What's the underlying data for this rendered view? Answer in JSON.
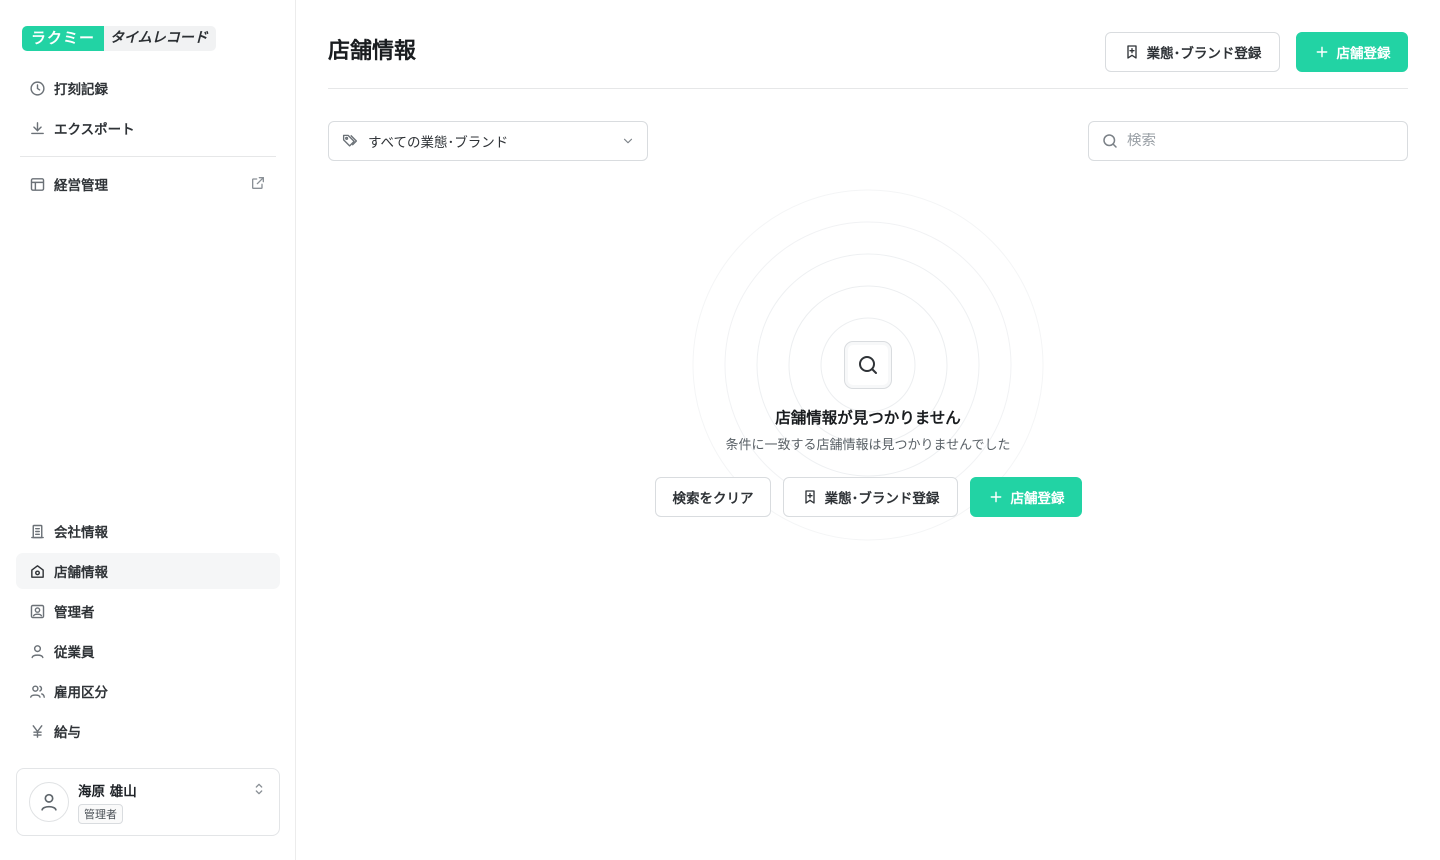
{
  "app": {
    "logo_main": "ラクミー",
    "logo_sub": "タイムレコード"
  },
  "sidebar": {
    "top_items": [
      {
        "label": "打刻記録",
        "icon": "clock-icon"
      },
      {
        "label": "エクスポート",
        "icon": "download-icon"
      }
    ],
    "management_item": {
      "label": "経営管理",
      "icon": "layout-icon",
      "external_icon": "external-link-icon"
    },
    "bottom_items": [
      {
        "label": "会社情報",
        "icon": "building-icon"
      },
      {
        "label": "店舗情報",
        "icon": "store-icon",
        "active": true
      },
      {
        "label": "管理者",
        "icon": "admin-icon"
      },
      {
        "label": "従業員",
        "icon": "user-icon"
      },
      {
        "label": "雇用区分",
        "icon": "users-icon"
      },
      {
        "label": "給与",
        "icon": "yen-icon"
      }
    ],
    "user": {
      "name": "海原 雄山",
      "role": "管理者"
    }
  },
  "main": {
    "title": "店舗情報",
    "actions": {
      "brand_register_label": "業態･ブランド登録",
      "store_register_label": "店舗登録"
    },
    "filter": {
      "selected": "すべての業態･ブランド"
    },
    "search": {
      "placeholder": "検索"
    },
    "empty_state": {
      "title": "店舗情報が見つかりません",
      "description": "条件に一致する店舗情報は見つかりませんでした",
      "clear_label": "検索をクリア",
      "brand_register_label": "業態･ブランド登録",
      "store_register_label": "店舗登録"
    }
  },
  "colors": {
    "accent": "#22d3a4",
    "active_bg": "#f5f6f7",
    "border": "#d9dcdf"
  }
}
